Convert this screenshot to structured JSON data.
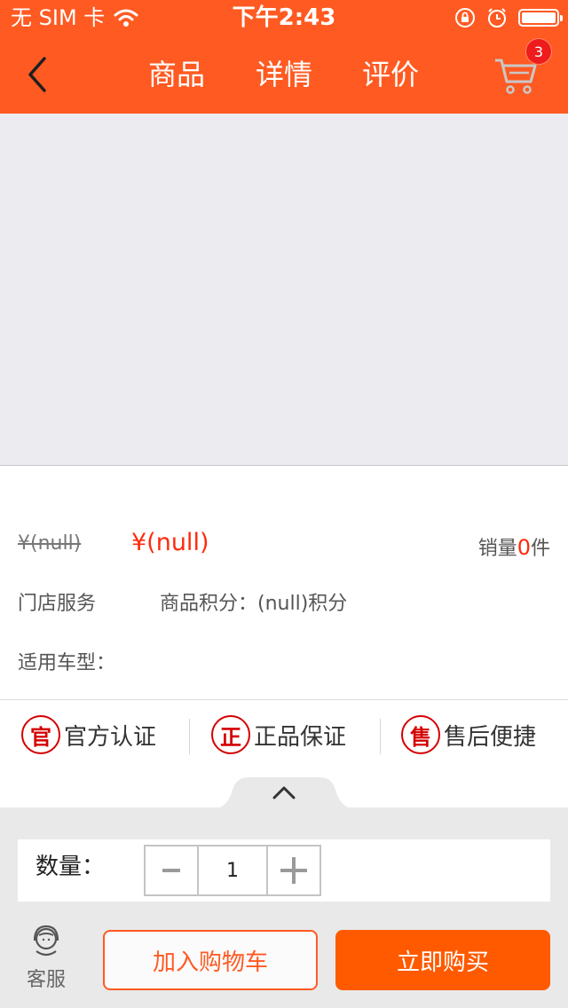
{
  "status_bar": {
    "carrier": "无 SIM 卡",
    "time": "下午2:43"
  },
  "nav": {
    "tabs": [
      "商品",
      "详情",
      "评价"
    ],
    "cart_count": "3"
  },
  "product": {
    "old_price": "¥(null)",
    "price": "¥(null)",
    "sales_label": "销量",
    "sales_count": "0",
    "sales_unit": "件",
    "store_service": "门店服务",
    "points": "商品积分：(null)积分",
    "vehicle": "适用车型："
  },
  "badges": [
    {
      "icon": "官",
      "label": "官方认证"
    },
    {
      "icon": "正",
      "label": "正品保证"
    },
    {
      "icon": "售",
      "label": "售后便捷"
    }
  ],
  "quantity": {
    "label": "数量：",
    "value": "1"
  },
  "bottom_bar": {
    "customer_service": "客服",
    "add_to_cart": "加入购物车",
    "buy_now": "立即购买"
  },
  "colors": {
    "brand": "#ff5a22",
    "price": "#ff2a0d",
    "badge_red": "#d40000"
  }
}
